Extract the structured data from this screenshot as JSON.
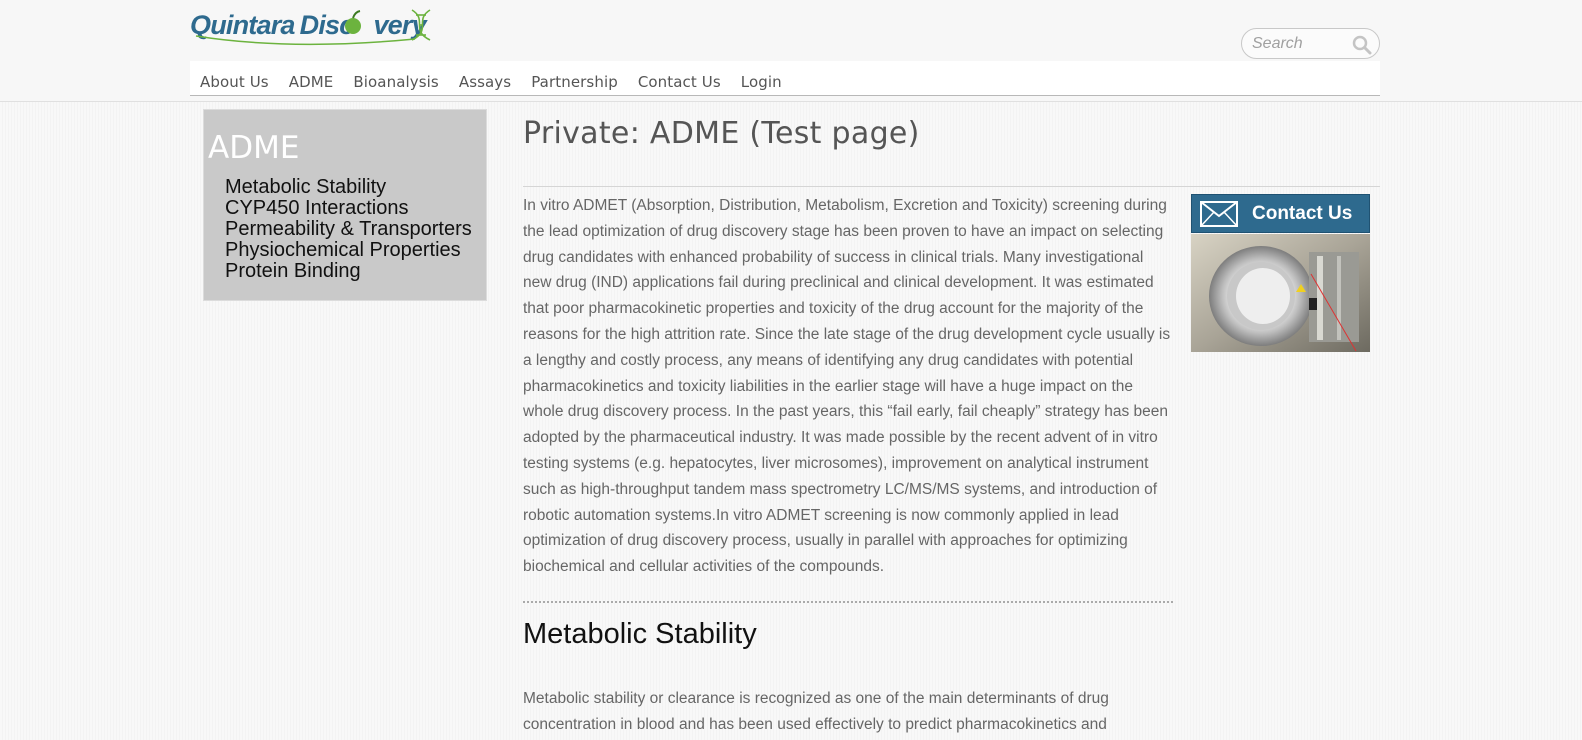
{
  "brand": {
    "name_part1": "Quintara",
    "name_part2": "Disc",
    "name_part3": "very",
    "colors": {
      "primary": "#2e6a8e",
      "accent": "#6cb33e"
    }
  },
  "search": {
    "placeholder": "Search",
    "icon": "search-icon"
  },
  "nav": {
    "items": [
      {
        "label": "About Us"
      },
      {
        "label": "ADME"
      },
      {
        "label": "Bioanalysis"
      },
      {
        "label": "Assays"
      },
      {
        "label": "Partnership"
      },
      {
        "label": "Contact Us"
      },
      {
        "label": "Login"
      }
    ]
  },
  "sidebar": {
    "title": "ADME",
    "items": [
      {
        "label": "Metabolic Stability"
      },
      {
        "label": "CYP450 Interactions"
      },
      {
        "label": "Permeability & Transporters"
      },
      {
        "label": "Physiochemical Properties"
      },
      {
        "label": "Protein Binding"
      }
    ]
  },
  "main": {
    "title": "Private: ADME (Test page)",
    "intro": "In vitro ADMET (Absorption, Distribution, Metabolism, Excretion and Toxicity) screening during the lead optimization of drug discovery stage has been proven to have an impact on selecting drug candidates with enhanced probability of success in clinical trials. Many investigational new drug (IND) applications fail during preclinical and clinical development. It was estimated that poor pharmacokinetic properties and toxicity of the drug account for the majority of the reasons for the high attrition rate. Since the late stage of the drug development cycle usually is a lengthy and costly process, any means of identifying any drug candidates with potential pharmacokinetics and toxicity liabilities in the earlier stage will have a huge impact on the whole drug discovery process. In the past years, this “fail early, fail cheaply” strategy has been adopted by the pharmaceutical industry. It was made possible by the recent advent of in vitro testing systems (e.g. hepatocytes, liver microsomes), improvement on analytical instrument such as high-throughput tandem mass spectrometry LC/MS/MS systems, and introduction of robotic automation systems.In vitro ADMET screening is now commonly applied in lead optimization of drug discovery process, usually in parallel with approaches for optimizing biochemical and cellular activities of the compounds.",
    "section_heading": "Metabolic Stability",
    "section_text": "Metabolic stability or clearance is recognized as one of the main determinants of drug concentration in blood and has been used effectively to predict pharmacokinetics and"
  },
  "contact_widget": {
    "label": "Contact Us",
    "icon": "mail-icon"
  }
}
